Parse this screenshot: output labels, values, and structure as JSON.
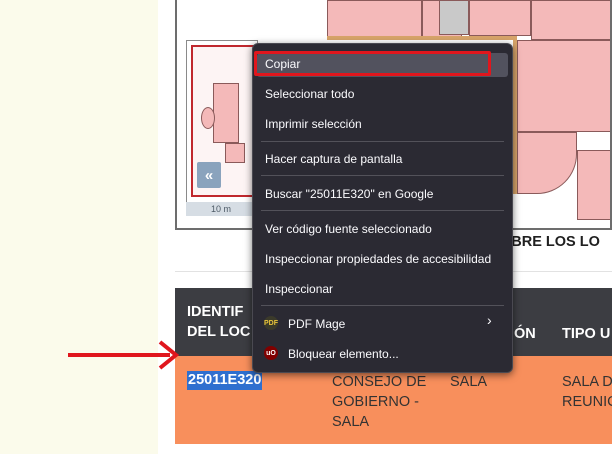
{
  "map": {
    "overview_scale": "10 m",
    "collapse_glyph": "«"
  },
  "section_heading_partial": "OBRE LOS LO",
  "table": {
    "headers": [
      {
        "text": "IDENTIF\nDEL LOC"
      },
      {
        "text": "ÓN"
      },
      {
        "text": "TIPO U"
      }
    ],
    "row": {
      "id": "25011E320",
      "name": "CONSEJO DE\nGOBIERNO -\nSALA",
      "location": "SALA",
      "type": "SALA D\nREUNIC"
    }
  },
  "context_menu": {
    "items": [
      {
        "label": "Copiar",
        "highlighted": true
      },
      {
        "label": "Seleccionar todo"
      },
      {
        "label": "Imprimir selección"
      },
      {
        "label": "Hacer captura de pantalla"
      },
      {
        "label": "Buscar \"25011E320\" en Google"
      },
      {
        "label": "Ver código fuente seleccionado"
      },
      {
        "label": "Inspeccionar propiedades de accesibilidad"
      },
      {
        "label": "Inspeccionar"
      },
      {
        "label": "PDF Mage",
        "icon": "pdf-mage-icon",
        "submenu": true
      },
      {
        "label": "Bloquear elemento...",
        "icon": "ublock-origin-icon"
      }
    ]
  },
  "colors": {
    "menu_bg": "#2b2a33",
    "menu_highlight": "#52525e",
    "focus_outline": "#e0161d",
    "table_header_bg": "#3c3d42",
    "table_row_bg": "#f88f5c",
    "selection_bg": "#2f6fcf",
    "arrow": "#e0161d"
  }
}
